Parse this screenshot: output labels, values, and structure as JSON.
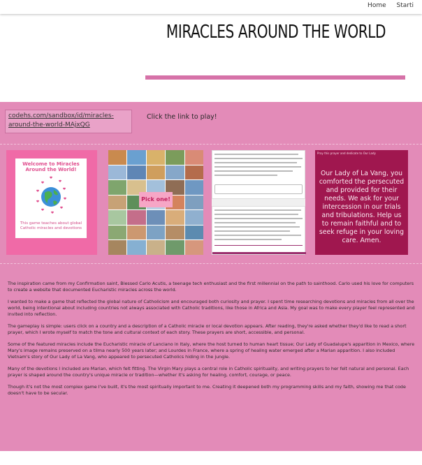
{
  "nav": {
    "home": "Home",
    "start": "Starti"
  },
  "page": {
    "title": "MIRACLES AROUND THE WORLD",
    "accent": "#d672a8",
    "band_color": "#e38bb8"
  },
  "link": {
    "url": "codehs.com/sandbox/id/miracles-around-the-world-MAjxQG",
    "caption": "Click the link to play!"
  },
  "thumbnails": {
    "welcome": {
      "heading": "Welcome to Miracles Around the World!",
      "blurb": "This game teaches about global Catholic miracles and devotions",
      "icon": "globe-with-hearts-icon"
    },
    "countries": {
      "button": "Pick one!"
    },
    "prayer": {
      "caption": "Pray this prayer and dedicate to Our Lady",
      "text": "Our Lady of La Vang, you comforted the persecuted and provided for their needs. We ask for your intercession in our trials and tribulations. Help us to remain faithful and to seek refuge in your loving care. Amen."
    }
  },
  "description": [
    "The inspiration came from my Confirmation saint, Blessed Carlo Acutis, a teenage tech enthusiast and the first millennial on the path to sainthood. Carlo used his love for computers to create a website that documented Eucharistic miracles across the world.",
    "I wanted to make a game that reflected the global nature of Catholicism and encouraged both curiosity and prayer. I spent time researching devotions and miracles from all over the world, being intentional about including countries not always associated with Catholic traditions, like those in Africa and Asia. My goal was to make every player feel represented and invited into reflection.",
    "The gameplay is simple: users click on a country and a description of a Catholic miracle or local devotion appears. After reading, they're asked whether they'd like to read a short prayer, which I wrote myself to match the tone and cultural context of each story. These prayers are short, accessible, and personal.",
    "Some of the featured miracles include the Eucharistic miracle of Lanciano in Italy, where the host turned to human heart tissue; Our Lady of Guadalupe's apparition in Mexico, where Mary's image remains preserved on a tilma nearly 500 years later; and Lourdes in France, where a spring of healing water emerged after a Marian apparition. I also included Vietnam's story of Our Lady of La Vang, who appeared to persecuted Catholics hiding in the jungle.",
    "Many of the devotions I included are Marian, which felt fitting. The Virgin Mary plays a central role in Catholic spirituality, and writing prayers to her felt natural and personal. Each prayer is shaped around the country's unique miracle or tradition—whether it's asking for healing, comfort, courage, or peace.",
    "Though it's not the most complex game I've built, it's the most spiritually important to me. Creating it deepened both my programming skills and my faith, showing me that code doesn't have to be secular."
  ]
}
